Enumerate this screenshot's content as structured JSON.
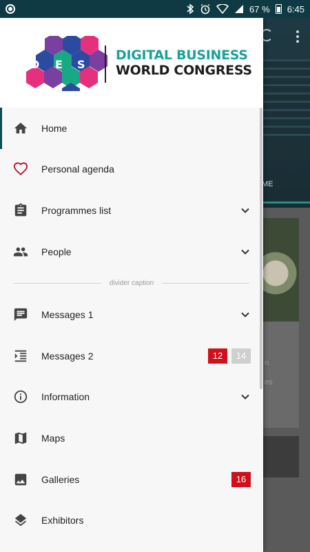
{
  "status_bar": {
    "battery": "67 %",
    "time": "6:45",
    "icons": [
      "bluetooth-icon",
      "alarm-icon",
      "wifi-icon",
      "signal-icon",
      "battery-icon"
    ]
  },
  "background": {
    "tab_fragment": "ME",
    "card_fragments": [
      "n",
      "es"
    ]
  },
  "logo": {
    "letters": [
      "D",
      "E",
      "S"
    ],
    "line1": "DIGITAL BUSINESS",
    "line2": "WORLD CONGRESS",
    "colors": {
      "teal": "#1aa39a",
      "dark": "#1d1d1d",
      "pink": "#e5317d",
      "blue": "#2c4aa0",
      "purple": "#7a3fa0",
      "green": "#19a884"
    }
  },
  "nav": {
    "items": [
      {
        "label": "Home",
        "icon": "home-icon",
        "active": true
      },
      {
        "label": "Personal agenda",
        "icon": "heart-icon"
      },
      {
        "label": "Programmes list",
        "icon": "clipboard-icon",
        "expandable": true
      },
      {
        "label": "People",
        "icon": "people-icon",
        "expandable": true
      }
    ],
    "divider_caption": "divider caption",
    "items2": [
      {
        "label": "Messages 1",
        "icon": "message-icon",
        "expandable": true
      },
      {
        "label": "Messages 2",
        "icon": "indent-list-icon",
        "badges": [
          "12",
          "14"
        ]
      },
      {
        "label": "Information",
        "icon": "info-icon",
        "expandable": true
      },
      {
        "label": "Maps",
        "icon": "map-icon"
      },
      {
        "label": "Galleries",
        "icon": "image-icon",
        "badges": [
          "16"
        ]
      },
      {
        "label": "Exhibitors",
        "icon": "layers-icon"
      }
    ]
  },
  "colors": {
    "status_bar": "#0f3a44",
    "active_indicator": "#104a55",
    "badge_red": "#d0101b",
    "badge_grey": "#cfcfcf",
    "heart": "#c0102a"
  }
}
